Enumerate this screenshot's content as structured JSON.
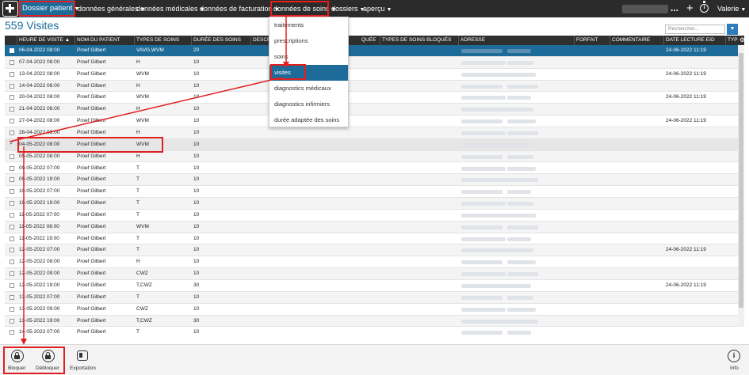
{
  "topbar": {
    "menus": [
      {
        "label": "Dossier patient"
      },
      {
        "label": "données générales"
      },
      {
        "label": "données médicales"
      },
      {
        "label": "données de facturation"
      },
      {
        "label": "données de soins"
      },
      {
        "label": "dossiers"
      },
      {
        "label": "aperçu"
      }
    ],
    "more": "...",
    "add": "+",
    "user": "Valerie"
  },
  "page": {
    "title": "559 Visites",
    "search_placeholder": "Rechercher..."
  },
  "columns": [
    "HEURE DE VISITE",
    "NOM DU PATIENT",
    "TYPES DE SOINS",
    "DURÉE DES SOINS",
    "DESCRI",
    "QUÉE",
    "TYPES DE SOINS BLOQUÉS",
    "ADRESSE",
    "FORFAIT",
    "COMMENTAIRE",
    "DATE LECTURE EID",
    "TYP"
  ],
  "sort_indicator": "▲",
  "rows": [
    {
      "date": "06-04-2022 08:00",
      "name": "Proef Gilbert",
      "type": "VAVG,WVM",
      "duration": "20",
      "eid": "24-06-2022 11:19"
    },
    {
      "date": "07-04-2022 08:00",
      "name": "Proef Gilbert",
      "type": "H",
      "duration": "10",
      "eid": ""
    },
    {
      "date": "13-04-2022 08:00",
      "name": "Proef Gilbert",
      "type": "WVM",
      "duration": "10",
      "eid": "24-06-2022 11:19"
    },
    {
      "date": "14-04-2022 08:00",
      "name": "Proef Gilbert",
      "type": "H",
      "duration": "10",
      "eid": ""
    },
    {
      "date": "20-04-2022 08:00",
      "name": "Proef Gilbert",
      "type": "WVM",
      "duration": "10",
      "eid": "24-06-2022 11:19"
    },
    {
      "date": "21-04-2022 08:00",
      "name": "Proef Gilbert",
      "type": "H",
      "duration": "10",
      "eid": ""
    },
    {
      "date": "27-04-2022 08:00",
      "name": "Proef Gilbert",
      "type": "WVM",
      "duration": "10",
      "eid": "24-06-2022 11:19"
    },
    {
      "date": "28-04-2022 08:00",
      "name": "Proef Gilbert",
      "type": "H",
      "duration": "10",
      "eid": ""
    },
    {
      "date": "04-05-2022 08:00",
      "name": "Proef Gilbert",
      "type": "WVM",
      "duration": "10",
      "eid": ""
    },
    {
      "date": "05-05-2022 08:00",
      "name": "Proef Gilbert",
      "type": "H",
      "duration": "10",
      "eid": ""
    },
    {
      "date": "09-05-2022 07:00",
      "name": "Proef Gilbert",
      "type": "T",
      "duration": "10",
      "eid": ""
    },
    {
      "date": "09-05-2022 19:00",
      "name": "Proef Gilbert",
      "type": "T",
      "duration": "10",
      "eid": ""
    },
    {
      "date": "10-05-2022 07:00",
      "name": "Proef Gilbert",
      "type": "T",
      "duration": "10",
      "eid": ""
    },
    {
      "date": "10-05-2022 19:00",
      "name": "Proef Gilbert",
      "type": "T",
      "duration": "10",
      "eid": ""
    },
    {
      "date": "11-05-2022 07:00",
      "name": "Proef Gilbert",
      "type": "T",
      "duration": "10",
      "eid": ""
    },
    {
      "date": "11-05-2022 08:00",
      "name": "Proef Gilbert",
      "type": "WVM",
      "duration": "10",
      "eid": ""
    },
    {
      "date": "11-05-2022 19:00",
      "name": "Proef Gilbert",
      "type": "T",
      "duration": "10",
      "eid": ""
    },
    {
      "date": "12-05-2022 07:00",
      "name": "Proef Gilbert",
      "type": "T",
      "duration": "10",
      "eid": "24-06-2022 11:19"
    },
    {
      "date": "12-05-2022 08:00",
      "name": "Proef Gilbert",
      "type": "H",
      "duration": "10",
      "eid": ""
    },
    {
      "date": "12-05-2022 09:00",
      "name": "Proef Gilbert",
      "type": "CWZ",
      "duration": "10",
      "eid": ""
    },
    {
      "date": "12-05-2022 19:00",
      "name": "Proef Gilbert",
      "type": "T,CWZ",
      "duration": "30",
      "eid": "24-06-2022 11:19"
    },
    {
      "date": "13-05-2022 07:00",
      "name": "Proef Gilbert",
      "type": "T",
      "duration": "10",
      "eid": ""
    },
    {
      "date": "13-05-2022 09:00",
      "name": "Proef Gilbert",
      "type": "CWZ",
      "duration": "10",
      "eid": ""
    },
    {
      "date": "13-05-2022 19:00",
      "name": "Proef Gilbert",
      "type": "T,CWZ",
      "duration": "30",
      "eid": ""
    },
    {
      "date": "14-05-2022 07:00",
      "name": "Proef Gilbert",
      "type": "T",
      "duration": "10",
      "eid": ""
    }
  ],
  "dropdown": {
    "items": [
      {
        "label": "traitements"
      },
      {
        "label": "prescriptions"
      },
      {
        "label": "soins"
      },
      {
        "label": "visites"
      },
      {
        "label": "diagnostics médicaux"
      },
      {
        "label": "diagnostics infirmiers"
      },
      {
        "label": "durée adaptée des soins"
      }
    ]
  },
  "toolbar": {
    "lock": "Bloquer",
    "unlock": "Débloquer",
    "export": "Exportation",
    "info": "Info",
    "info_glyph": "i"
  },
  "colors": {
    "topbar": "#2b2b2b",
    "accent": "#1d6b99",
    "annotation": "#e02020"
  }
}
